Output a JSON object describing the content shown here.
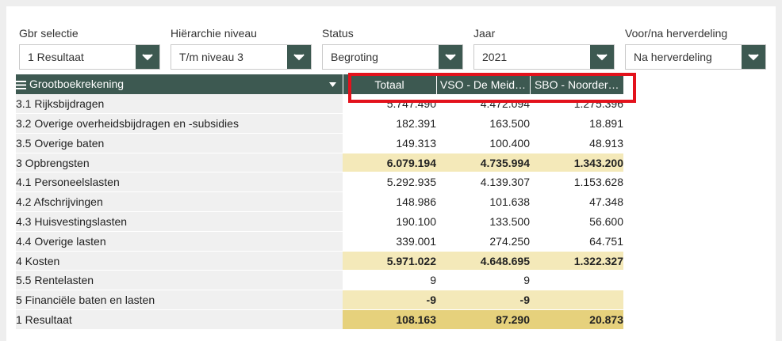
{
  "filters": [
    {
      "label": "Gbr selectie",
      "value": "1 Resultaat"
    },
    {
      "label": "Hiërarchie niveau",
      "value": "T/m niveau 3"
    },
    {
      "label": "Status",
      "value": "Begroting"
    },
    {
      "label": "Jaar",
      "value": "2021"
    },
    {
      "label": "Voor/na herverdeling",
      "value": "Na herverdeling"
    }
  ],
  "table": {
    "first_header": "Grootboekrekening",
    "headers": [
      "Totaal",
      "VSO - De Meid…",
      "SBO - Noorder…"
    ],
    "rows": [
      {
        "label": "3.1 Rijksbijdragen",
        "values": [
          "5.747.490",
          "4.472.094",
          "1.275.396"
        ]
      },
      {
        "label": "3.2 Overige overheidsbijdragen en -subsidies",
        "values": [
          "182.391",
          "163.500",
          "18.891"
        ]
      },
      {
        "label": "3.5 Overige baten",
        "values": [
          "149.313",
          "100.400",
          "48.913"
        ]
      },
      {
        "label": "3 Opbrengsten",
        "values": [
          "6.079.194",
          "4.735.994",
          "1.343.200"
        ]
      },
      {
        "label": "4.1 Personeelslasten",
        "values": [
          "5.292.935",
          "4.139.307",
          "1.153.628"
        ]
      },
      {
        "label": "4.2 Afschrijvingen",
        "values": [
          "148.986",
          "101.638",
          "47.348"
        ]
      },
      {
        "label": "4.3 Huisvestingslasten",
        "values": [
          "190.100",
          "133.500",
          "56.600"
        ]
      },
      {
        "label": "4.4 Overige lasten",
        "values": [
          "339.001",
          "274.250",
          "64.751"
        ]
      },
      {
        "label": "4 Kosten",
        "values": [
          "5.971.022",
          "4.648.695",
          "1.322.327"
        ]
      },
      {
        "label": "5.5 Rentelasten",
        "values": [
          "9",
          "9",
          ""
        ]
      },
      {
        "label": "5 Financiële baten en lasten",
        "values": [
          "-9",
          "-9",
          ""
        ]
      },
      {
        "label": "1 Resultaat",
        "values": [
          "108.163",
          "87.290",
          "20.873"
        ]
      }
    ]
  },
  "colors": {
    "header_bg": "#3d5951",
    "subtotal_bg": "#f4e9b9",
    "total_bg": "#e6d17c",
    "highlight_border": "#e3121c"
  }
}
